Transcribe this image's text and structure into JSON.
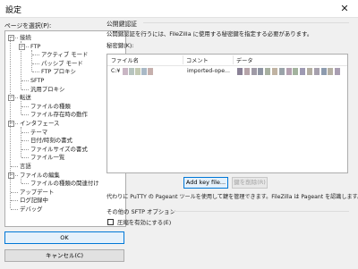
{
  "window": {
    "title": "設定",
    "close_glyph": "✕"
  },
  "left": {
    "label": "ページを選択(P):",
    "tree": [
      {
        "label": "接続",
        "depth": 0,
        "expander": "−"
      },
      {
        "label": "FTP",
        "depth": 1,
        "expander": "−"
      },
      {
        "label": "アクティブ モード",
        "depth": 2
      },
      {
        "label": "パッシブ モード",
        "depth": 2
      },
      {
        "label": "FTP プロキシ",
        "depth": 2
      },
      {
        "label": "SFTP",
        "depth": 1
      },
      {
        "label": "汎用プロキシ",
        "depth": 1
      },
      {
        "label": "転送",
        "depth": 0,
        "expander": "−"
      },
      {
        "label": "ファイルの種類",
        "depth": 1
      },
      {
        "label": "ファイル存在時の動作",
        "depth": 1
      },
      {
        "label": "インタフェース",
        "depth": 0,
        "expander": "−"
      },
      {
        "label": "テーマ",
        "depth": 1
      },
      {
        "label": "日付/時刻の書式",
        "depth": 1
      },
      {
        "label": "ファイルサイズの書式",
        "depth": 1
      },
      {
        "label": "ファイル一覧",
        "depth": 1
      },
      {
        "label": "言語",
        "depth": 0
      },
      {
        "label": "ファイルの編集",
        "depth": 0,
        "expander": "−"
      },
      {
        "label": "ファイルの種類の関連付け",
        "depth": 1
      },
      {
        "label": "アップデート",
        "depth": 0
      },
      {
        "label": "ログ記録中",
        "depth": 0
      },
      {
        "label": "デバッグ",
        "depth": 0
      }
    ],
    "ok_label": "OK",
    "cancel_label": "キャンセル(C)"
  },
  "right": {
    "section_title": "公開鍵認証",
    "description": "公開鍵認証を行うには、FileZilla に使用する秘密鍵を指定する必要があります。",
    "keys_label": "秘密鍵(K):",
    "columns": [
      "ファイル名",
      "コメント",
      "データ"
    ],
    "row": {
      "filename": "C:¥",
      "comment": "imported-ope..."
    },
    "add_key_label": "Add key file...",
    "remove_key_label": "鍵を削除(R)",
    "pageant_note": "代わりに PuTTY の Pageant ツールを使用して鍵を管理できます。FileZilla は Pageant を認識します。",
    "other_title": "その他の SFTP オプション",
    "compression_label": "圧縮を有効にする(E)"
  },
  "colors": {
    "redacted_filename": [
      "#c9b6c4",
      "#b7c4bf",
      "#c3c9b2",
      "#a9b9c6",
      "#c6b0ad"
    ],
    "redacted_data": [
      "#8a8196",
      "#b6a4a9",
      "#9f9aa6",
      "#8f95a3",
      "#a7b0a0",
      "#c0b3a2",
      "#9aa3a9",
      "#b4a0b0",
      "#a3b39e",
      "#9e9ab3",
      "#b3aea1",
      "#a6a0ad",
      "#8d9bae",
      "#b5b0a3",
      "#a99eb2"
    ],
    "redacted_comment_tail": [
      "#b9b2c2"
    ]
  }
}
